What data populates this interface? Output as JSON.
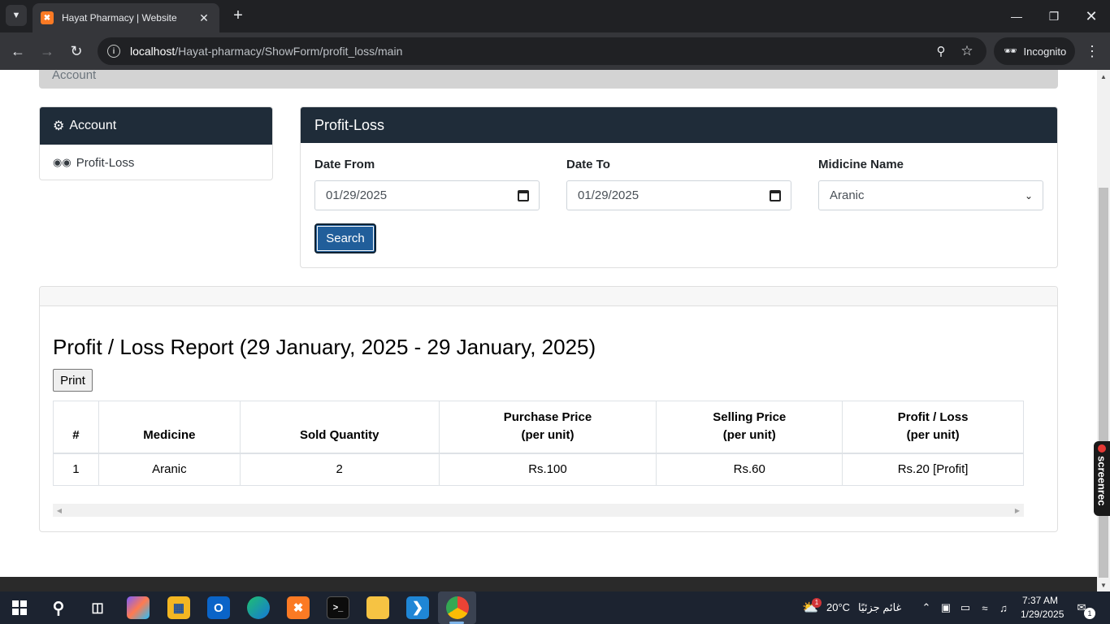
{
  "browser": {
    "tab_title": "Hayat Pharmacy | Website",
    "tab_favicon": "xampp-icon",
    "url_host": "localhost",
    "url_path": "/Hayat-pharmacy/ShowForm/profit_loss/main",
    "incognito_label": "Incognito"
  },
  "page": {
    "breadcrumb": "Account",
    "sidebar": {
      "title": "Account",
      "items": [
        {
          "label": "Profit-Loss"
        }
      ]
    },
    "form": {
      "title": "Profit-Loss",
      "date_from_label": "Date From",
      "date_from_value": "01/29/2025",
      "date_to_label": "Date To",
      "date_to_value": "01/29/2025",
      "medicine_label": "Midicine Name",
      "medicine_value": "Aranic",
      "search_label": "Search"
    },
    "report": {
      "title": "Profit / Loss Report (29 January, 2025 - 29 January, 2025)",
      "print_label": "Print",
      "columns": [
        {
          "line1": "#",
          "line2": ""
        },
        {
          "line1": "Medicine",
          "line2": ""
        },
        {
          "line1": "Sold Quantity",
          "line2": ""
        },
        {
          "line1": "Purchase Price",
          "line2": "(per unit)"
        },
        {
          "line1": "Selling Price",
          "line2": "(per unit)"
        },
        {
          "line1": "Profit / Loss",
          "line2": "(per unit)"
        }
      ],
      "rows": [
        [
          "1",
          "Aranic",
          "2",
          "Rs.100",
          "Rs.60",
          "Rs.20 [Profit]"
        ]
      ]
    },
    "screenrec_label": "screenrec"
  },
  "taskbar": {
    "weather_temp": "20°C",
    "weather_text": "غائم جزئيًا",
    "weather_badge": "1",
    "time": "7:37 AM",
    "date": "1/29/2025",
    "notification_count": "1"
  },
  "colors": {
    "panel_header": "#1f2c39",
    "search_button": "#215e9a"
  }
}
